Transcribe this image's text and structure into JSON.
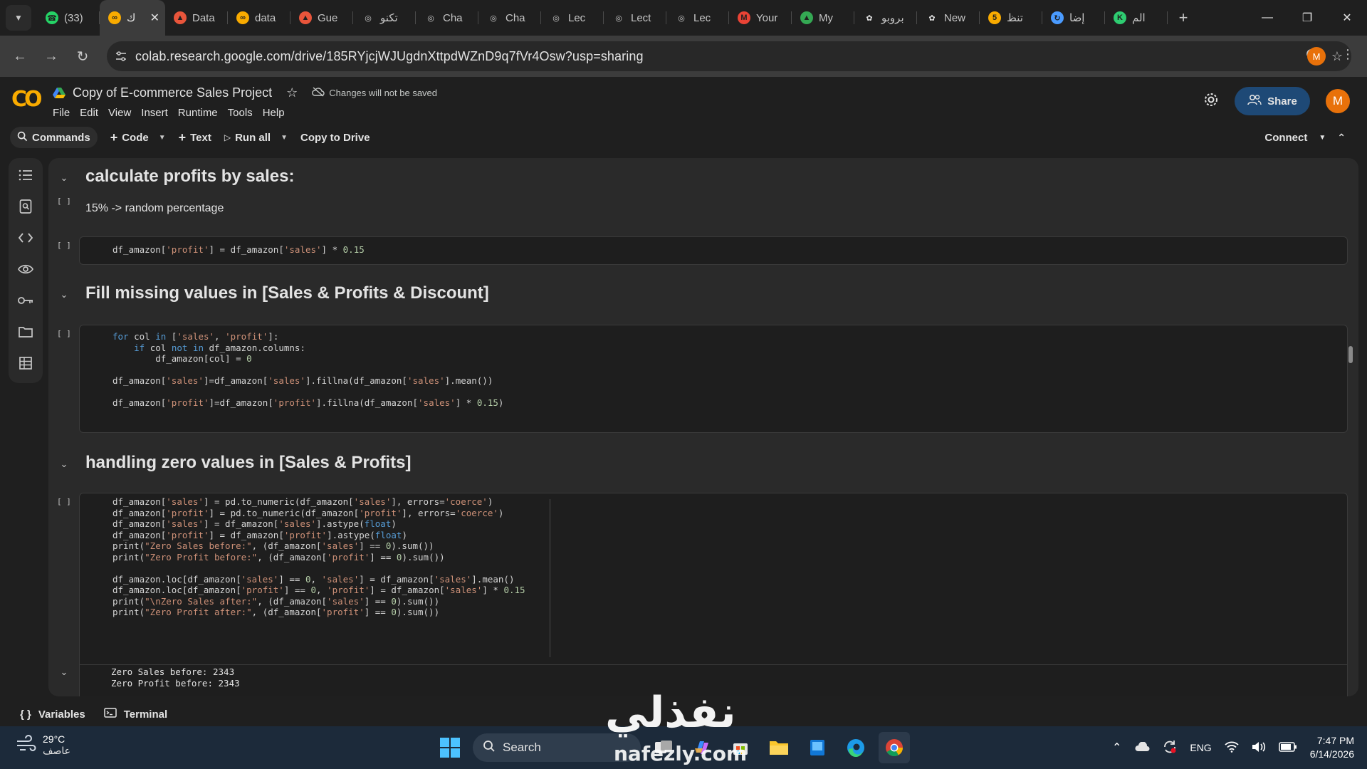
{
  "browser": {
    "tabs": [
      {
        "label": "(33)",
        "icon": "whatsapp-icon",
        "color": "#25d366"
      },
      {
        "label": "ك",
        "icon": "colab-icon",
        "color": "#f9ab00",
        "active": true
      },
      {
        "label": "Data",
        "icon": "kaggle-fox-icon",
        "color": "#e8553b"
      },
      {
        "label": "data",
        "icon": "colab-icon",
        "color": "#f9ab00"
      },
      {
        "label": "Gue",
        "icon": "kaggle-fox-icon",
        "color": "#e8553b"
      },
      {
        "label": "تكنو",
        "icon": "globe-icon",
        "color": "#c7c7c7"
      },
      {
        "label": "Cha",
        "icon": "globe-icon",
        "color": "#c7c7c7"
      },
      {
        "label": "Cha",
        "icon": "globe-icon",
        "color": "#c7c7c7"
      },
      {
        "label": "Lec",
        "icon": "globe-icon",
        "color": "#c7c7c7"
      },
      {
        "label": "Lect",
        "icon": "globe-icon",
        "color": "#c7c7c7"
      },
      {
        "label": "Lec",
        "icon": "globe-icon",
        "color": "#c7c7c7"
      },
      {
        "label": "Your",
        "icon": "gmail-icon",
        "color": "#ea4335"
      },
      {
        "label": "My",
        "icon": "drive-icon",
        "color": "#34a853"
      },
      {
        "label": "بروبو",
        "icon": "openai-icon",
        "color": "#e3e3e3"
      },
      {
        "label": "New",
        "icon": "openai-icon",
        "color": "#e3e3e3"
      },
      {
        "label": "تنظ",
        "icon": "number-5-icon",
        "color": "#f9ab00"
      },
      {
        "label": "إضا",
        "icon": "refresh-blue-icon",
        "color": "#4a9bff"
      },
      {
        "label": "الم",
        "icon": "k-logo-icon",
        "color": "#2ecc71"
      }
    ],
    "url": "colab.research.google.com/drive/185RYjcjWJUgdnXttpdWZnD9q7fVr4Osw?usp=sharing",
    "profile_initial": "M"
  },
  "colab": {
    "title": "Copy of E-commerce Sales Project",
    "save_note": "Changes will not be saved",
    "menu": [
      "File",
      "Edit",
      "View",
      "Insert",
      "Runtime",
      "Tools",
      "Help"
    ],
    "share_label": "Share",
    "avatar_initial": "M",
    "toolbar": {
      "commands": "Commands",
      "code": "Code",
      "text": "Text",
      "run_all": "Run all",
      "copy_to_drive": "Copy to Drive",
      "connect": "Connect"
    }
  },
  "notebook": {
    "section1_heading": "calculate profits by sales:",
    "section1_text": "15% -> random percentage",
    "cell1": [
      "df_amazon['profit'] = df_amazon['sales'] * 0.15"
    ],
    "section2_heading": "Fill missing values in [Sales & Profits & Discount]",
    "cell2": [
      "for col in ['sales', 'profit']:",
      "    if col not in df_amazon.columns:",
      "        df_amazon[col] = 0",
      "",
      "df_amazon['sales']=df_amazon['sales'].fillna(df_amazon['sales'].mean())",
      "",
      "df_amazon['profit']=df_amazon['profit'].fillna(df_amazon['sales'] * 0.15)"
    ],
    "section3_heading": "handling zero values in [Sales & Profits]",
    "cell3": [
      "df_amazon['sales'] = pd.to_numeric(df_amazon['sales'], errors='coerce')",
      "df_amazon['profit'] = pd.to_numeric(df_amazon['profit'], errors='coerce')",
      "df_amazon['sales'] = df_amazon['sales'].astype(float)",
      "df_amazon['profit'] = df_amazon['profit'].astype(float)",
      "print(\"Zero Sales before:\", (df_amazon['sales'] == 0).sum())",
      "print(\"Zero Profit before:\", (df_amazon['profit'] == 0).sum())",
      "",
      "df_amazon.loc[df_amazon['sales'] == 0, 'sales'] = df_amazon['sales'].mean()",
      "df_amazon.loc[df_amazon['profit'] == 0, 'profit'] = df_amazon['sales'] * 0.15",
      "print(\"\\nZero Sales after:\", (df_amazon['sales'] == 0).sum())",
      "print(\"Zero Profit after:\", (df_amazon['profit'] == 0).sum())"
    ],
    "cell3_output": [
      "Zero Sales before: 2343",
      "Zero Profit before: 2343"
    ],
    "run_marker": "[ ]"
  },
  "bottom_panel": {
    "variables": "Variables",
    "terminal": "Terminal"
  },
  "taskbar": {
    "temperature": "29°C",
    "condition": "عاصف",
    "search": "Search",
    "language": "ENG",
    "time": "7:47 PM",
    "date": "6/14/2026"
  },
  "watermark": {
    "arabic": "نفذلي",
    "latin": "nafezly.com"
  }
}
